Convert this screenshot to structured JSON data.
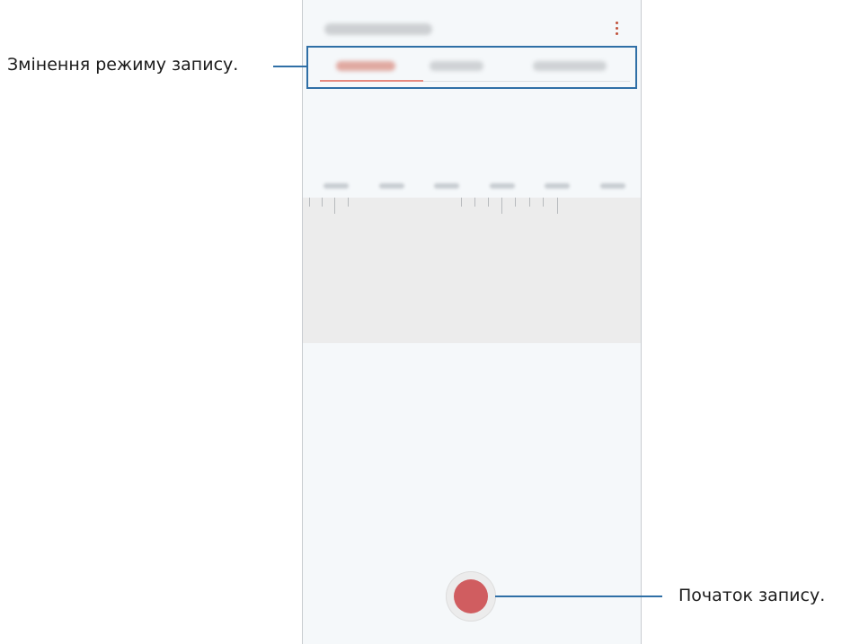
{
  "app": {
    "overflow_menu_icon": "more-vertical-icon"
  },
  "tabs": [
    {
      "state": "active"
    },
    {
      "state": "inactive"
    },
    {
      "state": "inactive"
    }
  ],
  "callouts": {
    "mode_change": "Змінення режиму запису.",
    "start_recording": "Початок запису."
  },
  "colors": {
    "highlight_box": "#2f6fa6",
    "record_button": "#d05d60",
    "active_tab_underline": "#e68a80",
    "overflow_icon": "#c0523b"
  },
  "icons": {
    "record": "record-icon"
  }
}
